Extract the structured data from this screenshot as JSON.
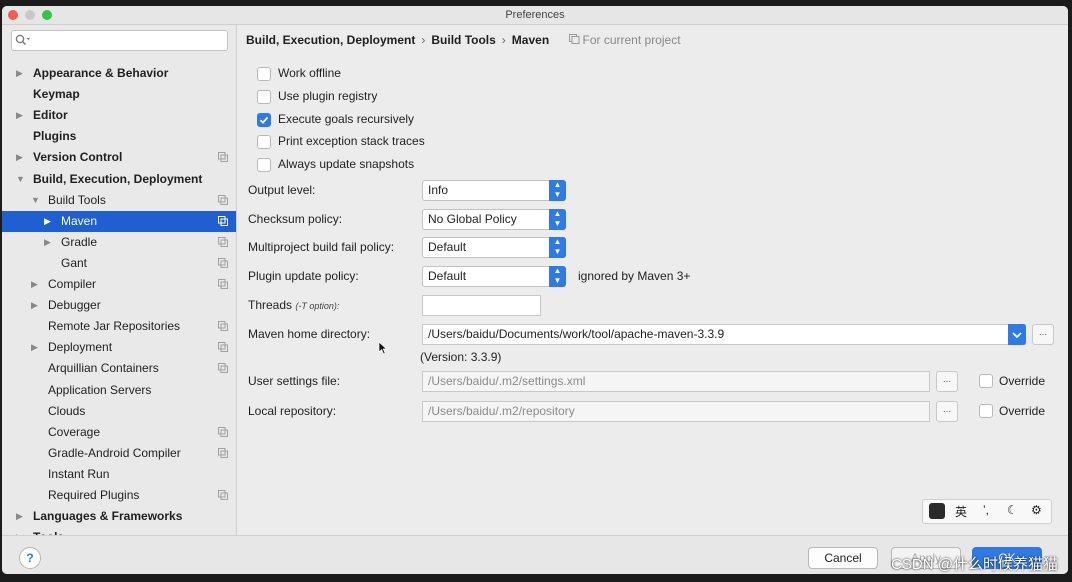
{
  "window": {
    "title": "Preferences"
  },
  "colors": {
    "accent": "#1f5fd1",
    "checkbox_on": "#2f7ae5"
  },
  "search": {
    "placeholder": ""
  },
  "sidebar": {
    "items": [
      {
        "label": "Appearance & Behavior",
        "bold": true,
        "arrow": "right",
        "indent": 0,
        "proj": false
      },
      {
        "label": "Keymap",
        "bold": true,
        "arrow": "",
        "indent": 0,
        "proj": false
      },
      {
        "label": "Editor",
        "bold": true,
        "arrow": "right",
        "indent": 0,
        "proj": false
      },
      {
        "label": "Plugins",
        "bold": true,
        "arrow": "",
        "indent": 0,
        "proj": false
      },
      {
        "label": "Version Control",
        "bold": true,
        "arrow": "right",
        "indent": 0,
        "proj": true
      },
      {
        "label": "Build, Execution, Deployment",
        "bold": true,
        "arrow": "down",
        "indent": 0,
        "proj": false
      },
      {
        "label": "Build Tools",
        "bold": false,
        "arrow": "down",
        "indent": 1,
        "proj": true
      },
      {
        "label": "Maven",
        "bold": false,
        "arrow": "right",
        "indent": 2,
        "proj": true,
        "selected": true
      },
      {
        "label": "Gradle",
        "bold": false,
        "arrow": "right",
        "indent": 2,
        "proj": true
      },
      {
        "label": "Gant",
        "bold": false,
        "arrow": "",
        "indent": 2,
        "proj": true
      },
      {
        "label": "Compiler",
        "bold": false,
        "arrow": "right",
        "indent": 1,
        "proj": true
      },
      {
        "label": "Debugger",
        "bold": false,
        "arrow": "right",
        "indent": 1,
        "proj": false
      },
      {
        "label": "Remote Jar Repositories",
        "bold": false,
        "arrow": "",
        "indent": 1,
        "proj": true
      },
      {
        "label": "Deployment",
        "bold": false,
        "arrow": "right",
        "indent": 1,
        "proj": true
      },
      {
        "label": "Arquillian Containers",
        "bold": false,
        "arrow": "",
        "indent": 1,
        "proj": true
      },
      {
        "label": "Application Servers",
        "bold": false,
        "arrow": "",
        "indent": 1,
        "proj": false
      },
      {
        "label": "Clouds",
        "bold": false,
        "arrow": "",
        "indent": 1,
        "proj": false
      },
      {
        "label": "Coverage",
        "bold": false,
        "arrow": "",
        "indent": 1,
        "proj": true
      },
      {
        "label": "Gradle-Android Compiler",
        "bold": false,
        "arrow": "",
        "indent": 1,
        "proj": true
      },
      {
        "label": "Instant Run",
        "bold": false,
        "arrow": "",
        "indent": 1,
        "proj": false
      },
      {
        "label": "Required Plugins",
        "bold": false,
        "arrow": "",
        "indent": 1,
        "proj": true
      },
      {
        "label": "Languages & Frameworks",
        "bold": true,
        "arrow": "right",
        "indent": 0,
        "proj": false
      },
      {
        "label": "Tools",
        "bold": true,
        "arrow": "right",
        "indent": 0,
        "proj": false
      }
    ]
  },
  "breadcrumb": {
    "part1": "Build, Execution, Deployment",
    "part2": "Build Tools",
    "part3": "Maven",
    "sep": "›",
    "hint": "For current project"
  },
  "checkboxes": [
    {
      "label": "Work offline",
      "checked": false
    },
    {
      "label": "Use plugin registry",
      "checked": false
    },
    {
      "label": "Execute goals recursively",
      "checked": true
    },
    {
      "label": "Print exception stack traces",
      "checked": false
    },
    {
      "label": "Always update snapshots",
      "checked": false
    }
  ],
  "fields": {
    "output_level": {
      "label": "Output level:",
      "value": "Info"
    },
    "checksum": {
      "label": "Checksum policy:",
      "value": "No Global Policy"
    },
    "multiproject": {
      "label": "Multiproject build fail policy:",
      "value": "Default"
    },
    "plugin_update": {
      "label": "Plugin update policy:",
      "value": "Default",
      "note": "ignored by Maven 3+"
    },
    "threads": {
      "label": "Threads",
      "hint": "(-T option):",
      "value": ""
    },
    "maven_home": {
      "label": "Maven home directory:",
      "value": "/Users/baidu/Documents/work/tool/apache-maven-3.3.9",
      "version": "(Version: 3.3.9)"
    },
    "user_settings": {
      "label": "User settings file:",
      "value": "/Users/baidu/.m2/settings.xml",
      "override": "Override"
    },
    "local_repo": {
      "label": "Local repository:",
      "value": "/Users/baidu/.m2/repository",
      "override": "Override"
    },
    "browse": "..."
  },
  "footer": {
    "help": "?",
    "cancel": "Cancel",
    "apply": "Apply",
    "ok": "OK"
  },
  "ime": {
    "lang": "英",
    "punct": "ʼ,",
    "moon": "☾",
    "gear": "⚙"
  },
  "watermark": "CSDN @什么时候养猫猫"
}
